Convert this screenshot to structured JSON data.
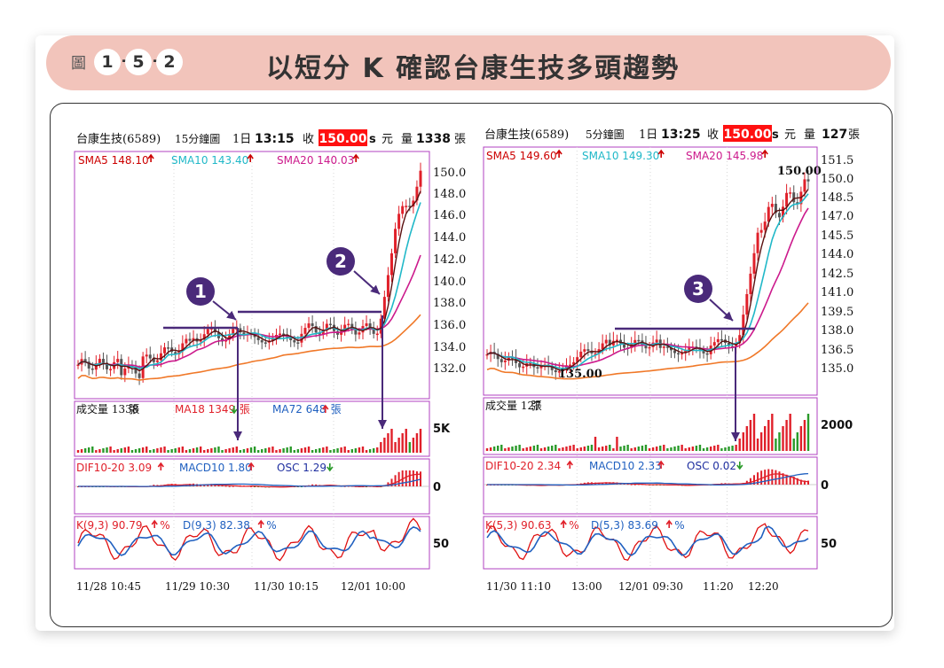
{
  "figure": {
    "label": "圖",
    "numbers": [
      "1",
      "5",
      "2"
    ],
    "dashes": [
      "-",
      "-"
    ],
    "title": "以短分 K 確認台康生技多頭趨勢"
  },
  "colors": {
    "banner": "#f2c4bb",
    "sma5": "#cc0000",
    "sma10": "#20b8c8",
    "sma20": "#cc1a8c",
    "ma_long": "#f07828",
    "up_candle": "#e0202a",
    "down_candle": "#555555",
    "price_badge": "#ff1010",
    "panel_border": "#b040c0",
    "callout": "#4a2a7a",
    "k_line": "#e01010",
    "d_line": "#2060c0"
  },
  "charts": [
    {
      "header": {
        "stock": "台康生技(6589)",
        "period": "15分鐘圖",
        "date": "1日",
        "time": "13:15",
        "close_label": "收",
        "close": "150.00",
        "unit_s": "s",
        "unit": "元",
        "vol_label": "量",
        "volume": "1338",
        "vol_unit": "張"
      },
      "sma_labels": [
        "SMA5 148.10",
        "SMA10 143.40",
        "SMA20 140.03"
      ],
      "price_ticks": [
        "150.0",
        "148.0",
        "146.0",
        "144.0",
        "142.0",
        "140.0",
        "138.0",
        "136.0",
        "134.0",
        "132.0"
      ],
      "volume_labels": [
        "成交量 1338",
        "張",
        "MA18 1349",
        "張",
        "MA72 648",
        "張"
      ],
      "volume_tick": "5K",
      "macd_labels": [
        "DIF10-20 3.09",
        "MACD10 1.80",
        "OSC 1.29"
      ],
      "macd_tick": "0",
      "kd_labels": [
        "K(9,3) 90.79",
        "%",
        "D(9,3) 82.38",
        "%"
      ],
      "kd_tick": "50",
      "x_labels": [
        "11/28 10:45",
        "11/29 10:30",
        "11/30 10:15",
        "12/01 10:00"
      ],
      "callouts": [
        "1",
        "2"
      ]
    },
    {
      "header": {
        "stock": "台康生技(6589)",
        "period": "5分鐘圖",
        "date": "1日",
        "time": "13:25",
        "close_label": "收",
        "close": "150.00",
        "unit_s": "s",
        "unit": "元",
        "vol_label": "量",
        "volume": "127",
        "vol_unit": "張"
      },
      "sma_labels": [
        "SMA5 149.60",
        "SMA10 149.30",
        "SMA20 145.98"
      ],
      "price_ticks": [
        "151.5",
        "150.0",
        "148.5",
        "147.0",
        "145.5",
        "144.0",
        "142.5",
        "141.0",
        "139.5",
        "138.0",
        "136.5",
        "135.0"
      ],
      "annotations": [
        "150.00",
        "135.00"
      ],
      "volume_labels": [
        "成交量 127",
        "張"
      ],
      "volume_tick": "2000",
      "macd_labels": [
        "DIF10-20 2.34",
        "MACD10 2.33",
        "OSC 0.02"
      ],
      "macd_tick": "0",
      "kd_labels": [
        "K(5,3) 90.63",
        "%",
        "D(5,3) 83.69",
        "%"
      ],
      "kd_tick": "50",
      "x_labels": [
        "11/30 11:10",
        "13:00",
        "12/01 09:30",
        "11:20",
        "12:20"
      ],
      "callouts": [
        "3"
      ]
    }
  ],
  "chart_data": [
    {
      "type": "candlestick",
      "title": "台康生技(6589) 15分鐘圖",
      "ylim": [
        131,
        151
      ],
      "x": [
        "11/28 10:45",
        "11/29 10:30",
        "11/30 10:15",
        "12/01 10:00"
      ],
      "series": [
        {
          "name": "SMA5",
          "last": 148.1
        },
        {
          "name": "SMA10",
          "last": 143.4
        },
        {
          "name": "SMA20",
          "last": 140.03
        }
      ],
      "close": 150.0,
      "volume": 1338
    },
    {
      "type": "candlestick",
      "title": "台康生技(6589) 5分鐘圖",
      "ylim": [
        134,
        152
      ],
      "x": [
        "11/30 11:10",
        "13:00",
        "12/01 09:30",
        "11:20",
        "12:20"
      ],
      "series": [
        {
          "name": "SMA5",
          "last": 149.6
        },
        {
          "name": "SMA10",
          "last": 149.3
        },
        {
          "name": "SMA20",
          "last": 145.98
        }
      ],
      "close": 150.0,
      "volume": 127,
      "marked_values": [
        150.0,
        135.0
      ]
    }
  ]
}
